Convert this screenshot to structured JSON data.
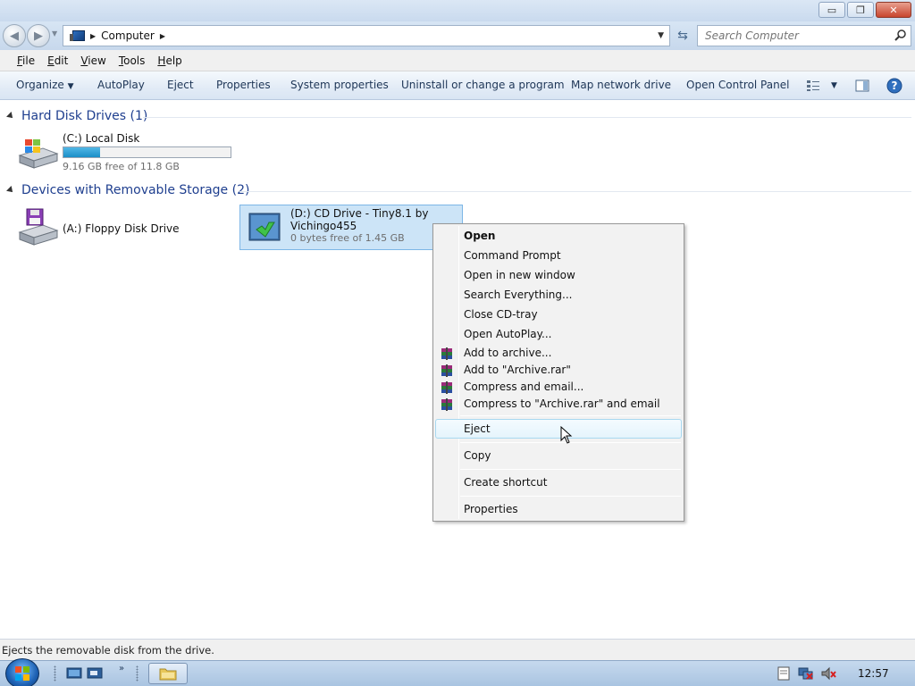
{
  "window": {
    "minimize_label": "▭",
    "restore_label": "❐",
    "close_label": "✕"
  },
  "address": {
    "location": "Computer",
    "search_placeholder": "Search Computer"
  },
  "menu": {
    "file": {
      "accel": "F",
      "rest": "ile"
    },
    "edit": {
      "accel": "E",
      "rest": "dit"
    },
    "view": {
      "accel": "V",
      "rest": "iew"
    },
    "tools": {
      "accel": "T",
      "rest": "ools"
    },
    "help": {
      "accel": "H",
      "rest": "elp"
    }
  },
  "commands": {
    "organize": "Organize",
    "autoplay": "AutoPlay",
    "eject": "Eject",
    "properties": "Properties",
    "system_properties": "System properties",
    "uninstall": "Uninstall or change a program",
    "map_drive": "Map network drive",
    "control_panel": "Open Control Panel"
  },
  "groups": {
    "hard_disks": {
      "title": "Hard Disk Drives (1)",
      "drives": [
        {
          "name": "(C:) Local Disk",
          "free": "9.16 GB free of 11.8 GB",
          "used_fraction": 0.22
        }
      ]
    },
    "removable": {
      "title": "Devices with Removable Storage (2)",
      "drives": [
        {
          "name": "(A:) Floppy Disk Drive"
        },
        {
          "name_line1": "(D:) CD Drive - Tiny8.1 by",
          "name_line2": "Vichingo455",
          "free": "0 bytes free of 1.45 GB"
        }
      ]
    }
  },
  "context_menu": {
    "open": "Open",
    "command_prompt": "Command Prompt",
    "open_new_window": "Open in new window",
    "search_everything": "Search Everything...",
    "close_tray": "Close CD-tray",
    "open_autoplay": "Open AutoPlay...",
    "add_archive": "Add to archive...",
    "add_archive_rar": "Add to \"Archive.rar\"",
    "compress_email": "Compress and email...",
    "compress_rar_email": "Compress to \"Archive.rar\" and email",
    "eject": "Eject",
    "copy": "Copy",
    "create_shortcut": "Create shortcut",
    "properties": "Properties"
  },
  "status": {
    "text": "Ejects the removable disk from the drive."
  },
  "taskbar": {
    "clock": "12:57"
  }
}
